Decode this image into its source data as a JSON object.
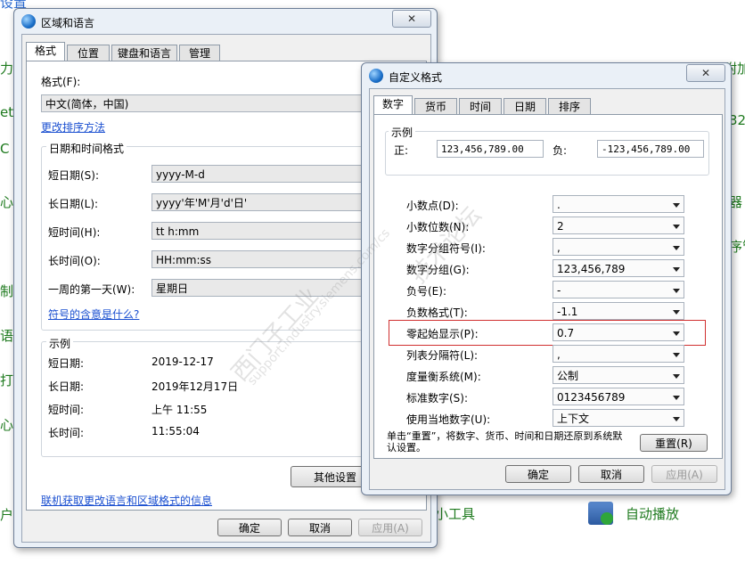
{
  "background": {
    "left_fragments": [
      "设置",
      "力能",
      "et",
      "C 和",
      "心",
      "制",
      "语",
      "打",
      "心",
      "户"
    ],
    "right_fragments": [
      "32",
      "器",
      "序管",
      "附加"
    ],
    "bottom_items": [
      "小工具",
      "自动播放"
    ]
  },
  "region_window": {
    "title": "区域和语言",
    "tabs": [
      "格式",
      "位置",
      "键盘和语言",
      "管理"
    ],
    "format_label": "格式(F):",
    "format_value": "中文(简体，中国)",
    "sort_link": "更改排序方法",
    "datetime_group": "日期和时间格式",
    "rows": [
      {
        "label": "短日期(S):",
        "value": "yyyy-M-d"
      },
      {
        "label": "长日期(L):",
        "value": "yyyy'年'M'月'd'日'"
      },
      {
        "label": "短时间(H):",
        "value": "tt h:mm"
      },
      {
        "label": "长时间(O):",
        "value": "HH:mm:ss"
      },
      {
        "label": "一周的第一天(W):",
        "value": "星期日"
      }
    ],
    "symbols_link": "符号的含意是什么?",
    "example_group": "示例",
    "examples": [
      {
        "label": "短日期:",
        "value": "2019-12-17"
      },
      {
        "label": "长日期:",
        "value": "2019年12月17日"
      },
      {
        "label": "短时间:",
        "value": "上午 11:55"
      },
      {
        "label": "长时间:",
        "value": "11:55:04"
      }
    ],
    "other_settings": "其他设置",
    "online_link": "联机获取更改语言和区域格式的信息",
    "ok": "确定",
    "cancel": "取消",
    "apply": "应用(A)"
  },
  "custom_window": {
    "title": "自定义格式",
    "close": "✕",
    "tabs": [
      "数字",
      "货币",
      "时间",
      "日期",
      "排序"
    ],
    "example_group": "示例",
    "positive_label": "正:",
    "positive_value": "123,456,789.00",
    "negative_label": "负:",
    "negative_value": "-123,456,789.00",
    "rows": [
      {
        "label": "小数点(D):",
        "value": "."
      },
      {
        "label": "小数位数(N):",
        "value": "2"
      },
      {
        "label": "数字分组符号(I):",
        "value": ","
      },
      {
        "label": "数字分组(G):",
        "value": "123,456,789"
      },
      {
        "label": "负号(E):",
        "value": "-"
      },
      {
        "label": "负数格式(T):",
        "value": "-1.1"
      },
      {
        "label": "零起始显示(P):",
        "value": "0.7"
      },
      {
        "label": "列表分隔符(L):",
        "value": ","
      },
      {
        "label": "度量衡系统(M):",
        "value": "公制"
      },
      {
        "label": "标准数字(S):",
        "value": "0123456789"
      },
      {
        "label": "使用当地数字(U):",
        "value": "上下文"
      }
    ],
    "reset_note": "单击“重置”，将数字、货币、时间和日期还原到系统默认设置。",
    "reset": "重置(R)",
    "ok": "确定",
    "cancel": "取消",
    "apply": "应用(A)"
  },
  "region_close": "✕",
  "watermark": [
    "西门子工业",
    "support.industry.siemens.com/cs",
    "技术论坛"
  ]
}
